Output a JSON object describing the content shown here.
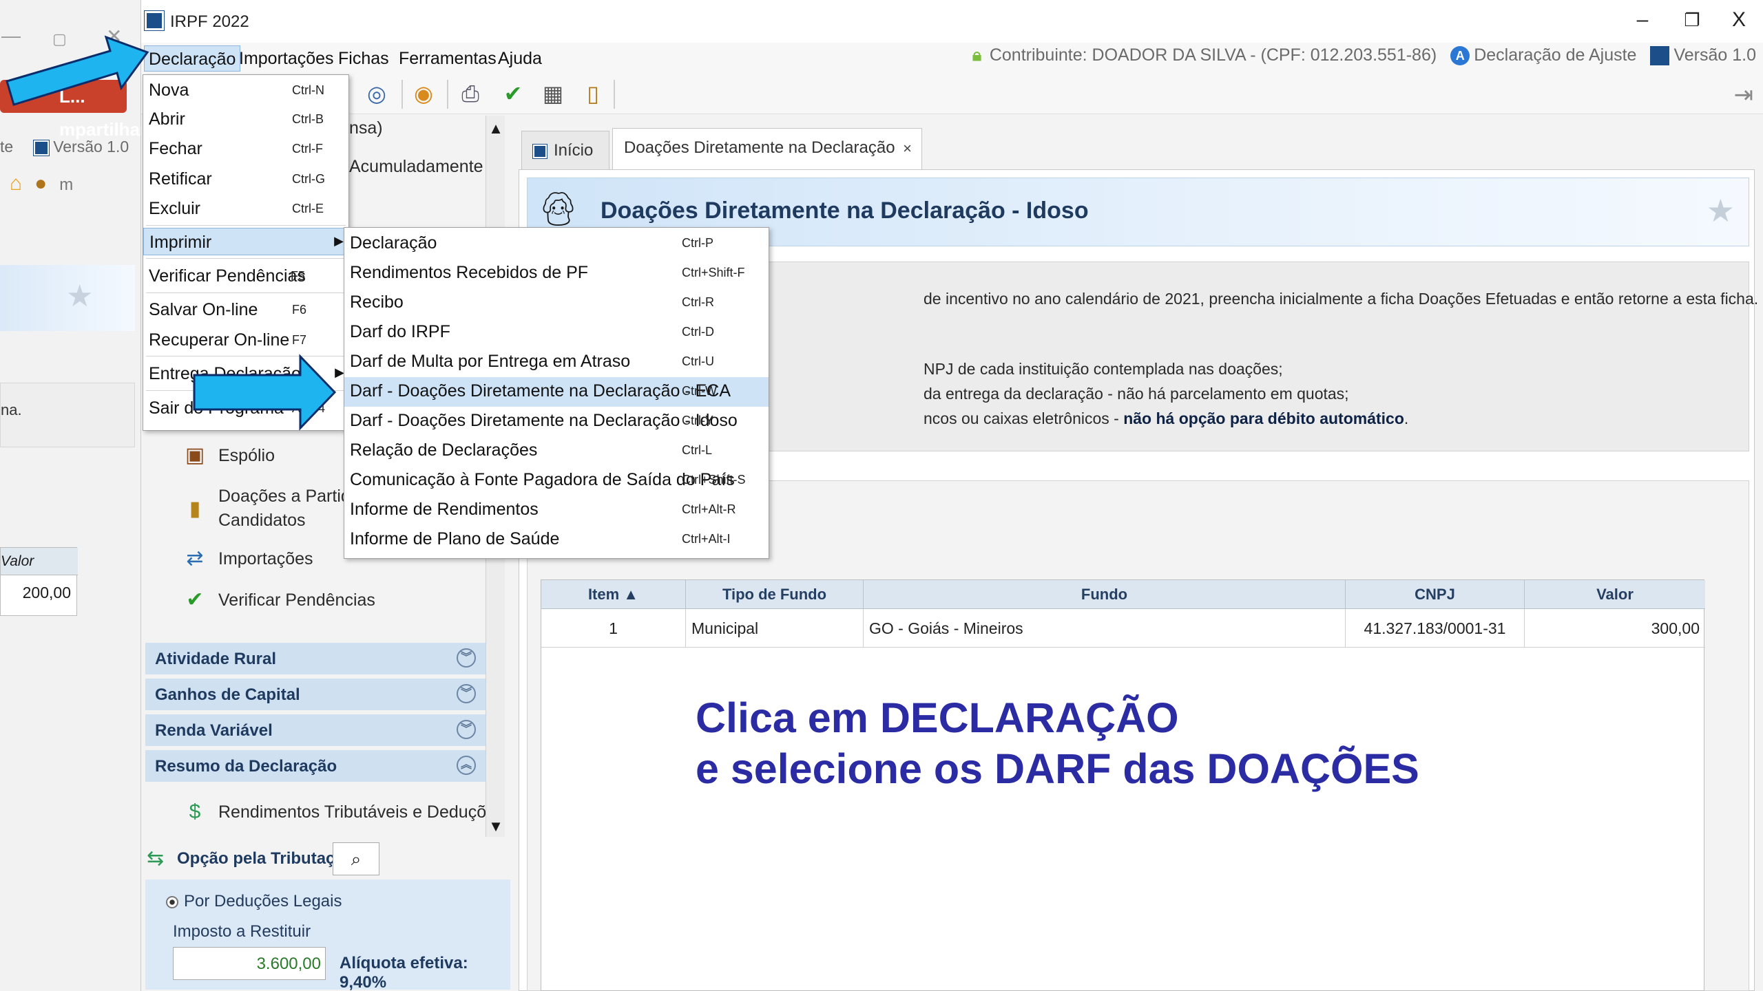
{
  "background_window": {
    "controls": [
      "—",
      "▢",
      "✕"
    ],
    "share_label": "L... mpartilhar",
    "version_label": "Versão 1.0",
    "info_text": "na.",
    "table_header": "Valor",
    "table_value": "200,00"
  },
  "window": {
    "title": "IRPF 2022",
    "minimize": "–",
    "restore": "❐",
    "close": "X"
  },
  "menubar": {
    "items": [
      "Declaração",
      "Importações",
      "Fichas",
      "Ferramentas",
      "Ajuda"
    ],
    "contribuinte": "Contribuinte: DOADOR DA SILVA - (CPF: 012.203.551-86)",
    "declaracao_tipo": "Declaração de Ajuste",
    "versao": "Versão 1.0"
  },
  "declaracao_menu": {
    "items": [
      {
        "label": "Nova",
        "shortcut": "Ctrl-N"
      },
      {
        "label": "Abrir",
        "shortcut": "Ctrl-B"
      },
      {
        "label": "Fechar",
        "shortcut": "Ctrl-F"
      },
      {
        "label": "Retificar",
        "shortcut": "Ctrl-G"
      },
      {
        "label": "Excluir",
        "shortcut": "Ctrl-E"
      },
      {
        "label": "Imprimir",
        "shortcut": ""
      },
      {
        "label": "Verificar Pendências",
        "shortcut": "F5"
      },
      {
        "label": "Salvar On-line",
        "shortcut": "F6"
      },
      {
        "label": "Recuperar On-line",
        "shortcut": "F7"
      },
      {
        "label": "Entrega Declaração",
        "shortcut": ""
      },
      {
        "label": "Sair do Programa",
        "shortcut": "Alt-F4"
      }
    ]
  },
  "imprimir_submenu": {
    "items": [
      {
        "label": "Declaração",
        "shortcut": "Ctrl-P"
      },
      {
        "label": "Rendimentos Recebidos de PF",
        "shortcut": "Ctrl+Shift-F"
      },
      {
        "label": "Recibo",
        "shortcut": "Ctrl-R"
      },
      {
        "label": "Darf do IRPF",
        "shortcut": "Ctrl-D"
      },
      {
        "label": "Darf de Multa por Entrega em Atraso",
        "shortcut": "Ctrl-U"
      },
      {
        "label": "Darf - Doações Diretamente na Declaração - ECA",
        "shortcut": "Ctrl-W"
      },
      {
        "label": "Darf - Doações Diretamente na Declaração - Idoso",
        "shortcut": "Ctrl-Y"
      },
      {
        "label": "Relação de Declarações",
        "shortcut": "Ctrl-L"
      },
      {
        "label": "Comunicação à Fonte Pagadora de Saída do País",
        "shortcut": "Ctrl+Shift-S"
      },
      {
        "label": "Informe de Rendimentos",
        "shortcut": "Ctrl+Alt-R"
      },
      {
        "label": "Informe de Plano de Saúde",
        "shortcut": "Ctrl+Alt-I"
      }
    ]
  },
  "nav": {
    "partial_top_1": "nsa)",
    "partial_top_2": "Acumuladamente",
    "links": [
      {
        "label": "Espólio",
        "icon": "chest-icon"
      },
      {
        "label": "Doações a Partidos Políticos e Candidatos",
        "line1": "Doações a Partidos Poli",
        "line2": "Candidatos",
        "icon": "lock-icon"
      },
      {
        "label": "Importações",
        "icon": "import-icon"
      },
      {
        "label": "Verificar Pendências",
        "icon": "checkmark-icon"
      }
    ],
    "sections": [
      {
        "label": "Atividade Rural",
        "chevron": "︾"
      },
      {
        "label": "Ganhos de Capital",
        "chevron": "︾"
      },
      {
        "label": "Renda Variável",
        "chevron": "︾"
      },
      {
        "label": "Resumo da Declaração",
        "chevron": "︽"
      }
    ],
    "resumo_link": "Rendimentos Tributáveis e Deduções"
  },
  "tributacao": {
    "label": "Opção pela Tributação:",
    "option": "Por Deduções Legais",
    "restituir_label": "Imposto a Restituir",
    "restituir_value": "3.600,00",
    "aliquota": "Alíquota efetiva: 9,40%"
  },
  "tabs": {
    "inicio": "Início",
    "doacoes": "Doações Diretamente na Declaração",
    "close": "×"
  },
  "page": {
    "title": "Doações Diretamente na Declaração - Idoso",
    "info_1": "de incentivo no ano calendário de 2021, preencha inicialmente a ficha Doações Efetuadas e então retorne a esta ficha.",
    "info_2": "NPJ de cada instituição contemplada nas doações;",
    "info_3": "da entrega da declaração - não há parcelamento em quotas;",
    "info_4a": "ncos ou caixas eletrônicos - ",
    "info_4b": "não há opção para débito automático",
    "info_4c": "."
  },
  "grid": {
    "headers": [
      "Item ▲",
      "Tipo de Fundo",
      "Fundo",
      "CNPJ",
      "Valor"
    ],
    "rows": [
      [
        "1",
        "Municipal",
        "GO - Goiás - Mineiros",
        "41.327.183/0001-31",
        "300,00"
      ]
    ]
  },
  "caption": {
    "line1": "Clica em DECLARAÇÃO",
    "line2": "e selecione os DARF das DOAÇÕES"
  },
  "colors": {
    "accent_arrow": "#1eb4ef",
    "caption": "#2b2ba4",
    "menu_highlight": "#cfe3f7",
    "header_title": "#1e3a5f"
  }
}
